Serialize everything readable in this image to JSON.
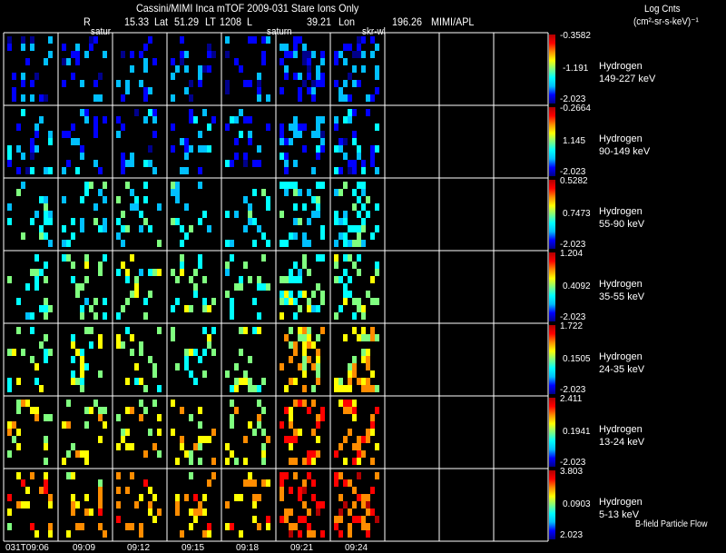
{
  "header": {
    "title": "Cassini/MIMI Inca mTOF  2009-031    Stare    Ions Only",
    "r_label": "R",
    "r_value": "15.33",
    "lat_label": "Lat",
    "lat_value": "51.29",
    "lt_label": "LT",
    "lt_value": "1208",
    "l_label": "L",
    "l_value": "39.21",
    "lon_label": "Lon",
    "lon_value": "196.26",
    "credit": "MIMI/APL",
    "units_line1": "Log Cnts",
    "units_line2": "(cm²-sr-s-keV)⁻¹"
  },
  "panel_annotations": [
    "satur",
    "saturn",
    "skr-wl"
  ],
  "footer_note": "B-field Particle Flow",
  "chart_data": {
    "type": "heatmap",
    "x_tick_labels": [
      "031T09:06",
      "09:09",
      "09:12",
      "09:15",
      "09:18",
      "09:21",
      "09:24"
    ],
    "columns_total": 10,
    "columns_with_data": 7,
    "colormap": [
      "#00008b",
      "#0000ff",
      "#00bfff",
      "#00ffff",
      "#7fff7f",
      "#ffff00",
      "#ff8c00",
      "#ff0000",
      "#b00000"
    ],
    "rows": [
      {
        "species": "Hydrogen",
        "energy": "149-227 keV",
        "cb_max": "-0.3582",
        "cb_mid": "-1.191",
        "cb_min": "-2.023"
      },
      {
        "species": "Hydrogen",
        "energy": "90-149 keV",
        "cb_max": "-0.2664",
        "cb_mid": "1.145",
        "cb_min": "-2.023"
      },
      {
        "species": "Hydrogen",
        "energy": "55-90 keV",
        "cb_max": "0.5282",
        "cb_mid": "0.7473",
        "cb_min": "-2.023"
      },
      {
        "species": "Hydrogen",
        "energy": "35-55 keV",
        "cb_max": "1.204",
        "cb_mid": "0.4092",
        "cb_min": "-2.023"
      },
      {
        "species": "Hydrogen",
        "energy": "24-35 keV",
        "cb_max": "1.722",
        "cb_mid": "0.1505",
        "cb_min": "-2.023"
      },
      {
        "species": "Hydrogen",
        "energy": "13-24 keV",
        "cb_max": "2.411",
        "cb_mid": "0.1941",
        "cb_min": "-2.023"
      },
      {
        "species": "Hydrogen",
        "energy": "5-13 keV",
        "cb_max": "3.803",
        "cb_mid": "0.0903",
        "cb_min": "2.023"
      }
    ]
  }
}
